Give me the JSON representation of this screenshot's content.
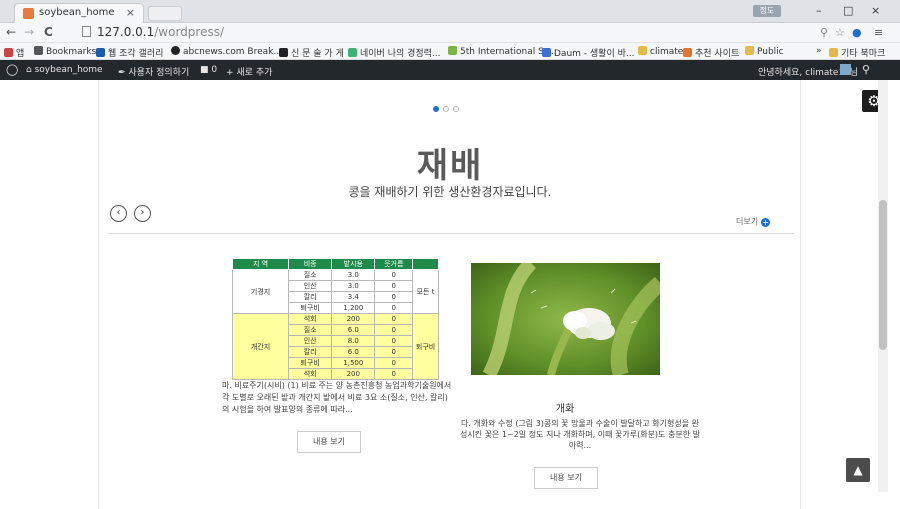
{
  "browser": {
    "tab_title": "soybean_home",
    "tab_close": "×",
    "user_badge": "정도",
    "window_controls": [
      "–",
      "□",
      "×"
    ],
    "url_host": "127.0.0.1",
    "url_path": "/wordpress/",
    "nav": [
      "←",
      "→",
      "C"
    ]
  },
  "bookmarks": {
    "items": [
      {
        "label": "앱",
        "color": "#c44"
      },
      {
        "label": "Bookmarks",
        "color": "#555"
      },
      {
        "label": "웹 조각 갤러리",
        "color": "#1a5ea8"
      },
      {
        "label": "abcnews.com Break...",
        "color": "#222"
      },
      {
        "label": "신 문 술 가 게",
        "color": "#222"
      },
      {
        "label": "네이버 나의 경정력...",
        "color": "#3cb371"
      },
      {
        "label": "5th International Sy...",
        "color": "#7cb342"
      },
      {
        "label": "Daum - 생활이 바...",
        "color": "#3b6fd4"
      },
      {
        "label": "climate",
        "color": "#e5b84c"
      },
      {
        "label": "추천 사이트",
        "color": "#e8732b"
      },
      {
        "label": "Public",
        "color": "#e5b84c"
      },
      {
        "label": "기타 북마크",
        "color": "#e5b84c"
      }
    ],
    "overflow": "»"
  },
  "wpbar": {
    "site": "soybean_home",
    "customize": "사용자 정의하기",
    "comments": "0",
    "new": "+ 새로 추가",
    "greeting": "안녕하세요, climate18님"
  },
  "hero": {
    "title": "재배",
    "subtitle": "콩을 재배하기 위한 생산환경자료입니다.",
    "more_label": "더보기",
    "prev": "‹",
    "next": "›"
  },
  "table": {
    "headers": [
      "지 역",
      "비종",
      "밭시용",
      "웃거름",
      ""
    ],
    "groups": [
      {
        "region": "기경지",
        "note": "모든 t",
        "highlight": false,
        "rows": [
          [
            "질소",
            "3.0",
            "0"
          ],
          [
            "인산",
            "3.0",
            "0"
          ],
          [
            "칼리",
            "3.4",
            "0"
          ],
          [
            "퇴구비",
            "1,200",
            "0"
          ]
        ]
      },
      {
        "region": "개간지",
        "note": "퇴구비",
        "highlight": true,
        "rows": [
          [
            "석회",
            "200",
            "0"
          ],
          [
            "질소",
            "6.0",
            "0"
          ],
          [
            "인산",
            "8.0",
            "0"
          ],
          [
            "칼리",
            "6.0",
            "0"
          ],
          [
            "퇴구비",
            "1,500",
            "0"
          ],
          [
            "석회",
            "200",
            "0"
          ]
        ]
      }
    ]
  },
  "cards": {
    "left_text": "마. 비료주기(시비) (1) 비료 주는 양 농촌진흥청 농업과학기술원에서 각 도별로 오래된 밭과 개간지 밭에서 비료 3요 소(질소, 인산, 칼리)의 시험을 하여 발표양의 종류에 따라...",
    "left_button": "내용 보기",
    "right_title": "개화",
    "right_text": "다. 개화와 수정          (그림 3)콩의 꽃 망울과 수술이 발달하고 화기형성을 완성시킨 꽃은 1~2일 정도 지나 개화하며, 이때 꽃가루(화분)도 충분한 발아력...",
    "right_button": "내용 보기"
  },
  "colors": {
    "accent": "#1f6fd1",
    "table_header": "#1e8b4a",
    "highlight": "#ffff9e",
    "wpbar": "#23282d"
  }
}
